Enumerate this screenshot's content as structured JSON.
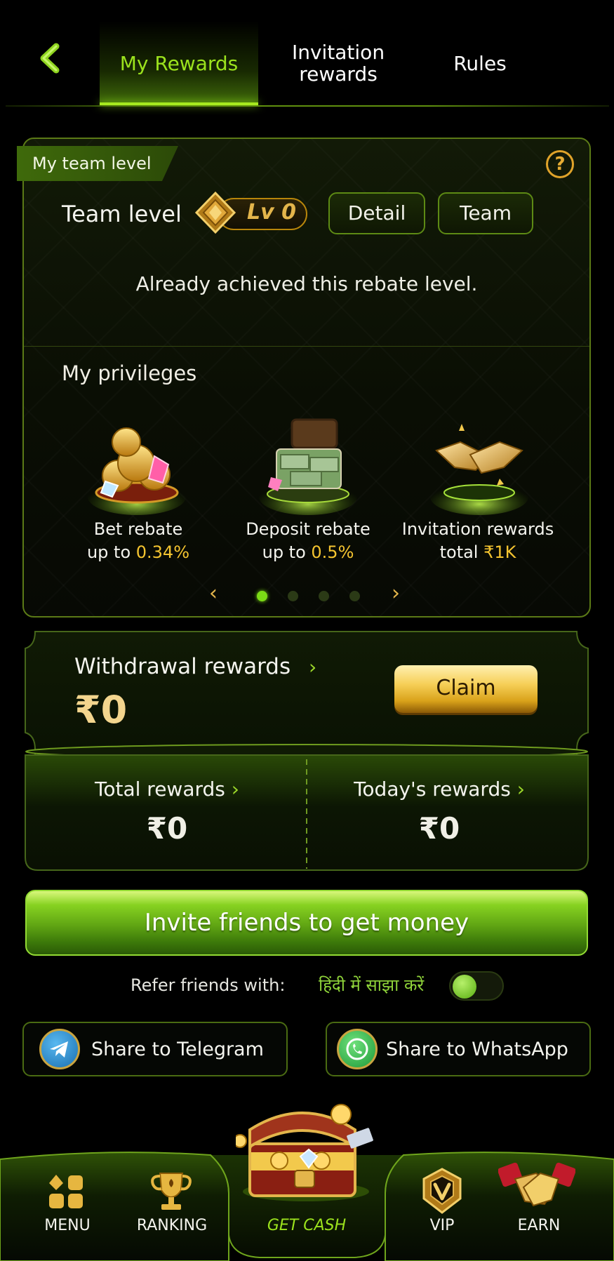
{
  "tabs": [
    {
      "label": "My Rewards",
      "active": true
    },
    {
      "label": "Invitation rewards",
      "active": false
    },
    {
      "label": "Rules",
      "active": false
    }
  ],
  "team": {
    "tag": "My team level",
    "team_level_label": "Team level",
    "level": "Lv 0",
    "detail_label": "Detail",
    "team_label": "Team",
    "status": "Already achieved this rebate level.",
    "privileges_title": "My privileges",
    "privileges": [
      {
        "line1": "Bet rebate",
        "prefix": "up to ",
        "value": "0.34%"
      },
      {
        "line1": "Deposit rebate",
        "prefix": "up to ",
        "value": "0.5%"
      },
      {
        "line1": "Invitation rewards",
        "prefix": "total ",
        "value": "₹1K"
      }
    ],
    "carousel": {
      "pages": 4,
      "current": 1
    }
  },
  "withdrawal": {
    "title": "Withdrawal rewards",
    "amount": "₹0",
    "claim_label": "Claim"
  },
  "totals": {
    "total_label": "Total rewards",
    "total_value": "₹0",
    "today_label": "Today's rewards",
    "today_value": "₹0"
  },
  "invite": {
    "button_label": "Invite friends to get money",
    "refer_label": "Refer friends with:",
    "refer_language": "हिंदी में साझा करें",
    "toggle_on": false
  },
  "share": {
    "telegram_label": "Share to Telegram",
    "whatsapp_label": "Share to WhatsApp"
  },
  "nav": [
    {
      "label": "MENU",
      "icon": "menu-grid-icon"
    },
    {
      "label": "RANKING",
      "icon": "trophy-icon"
    },
    {
      "label": "GET CASH",
      "icon": "treasure-chest-icon"
    },
    {
      "label": "VIP",
      "icon": "vip-shield-icon"
    },
    {
      "label": "EARN",
      "icon": "handshake-icon"
    }
  ],
  "colors": {
    "accent_green": "#9be21d",
    "gold": "#f4c430",
    "background": "#000000"
  }
}
